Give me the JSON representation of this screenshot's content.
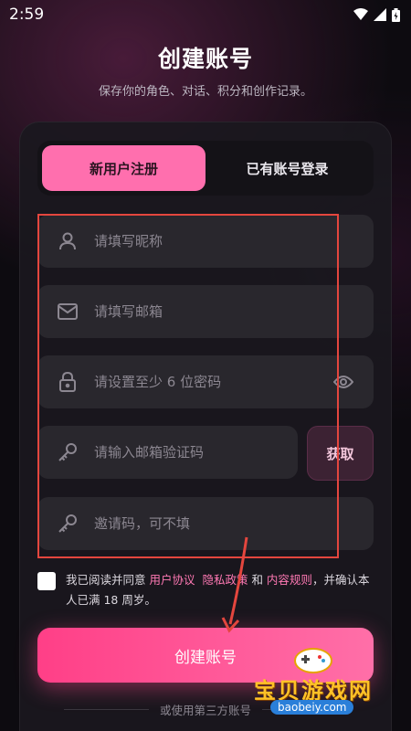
{
  "status_bar": {
    "time": "2:59"
  },
  "header": {
    "title": "创建账号",
    "subtitle": "保存你的角色、对话、积分和创作记录。"
  },
  "tabs": [
    {
      "label": "新用户注册",
      "active": true
    },
    {
      "label": "已有账号登录",
      "active": false
    }
  ],
  "form": {
    "nickname_placeholder": "请填写昵称",
    "email_placeholder": "请填写邮箱",
    "password_placeholder": "请设置至少 6 位密码",
    "code_placeholder": "请输入邮箱验证码",
    "get_code_label": "获取",
    "invite_placeholder": "邀请码，可不填"
  },
  "agreement": {
    "prefix": "我已阅读并同意 ",
    "user_agreement": "用户协议",
    "privacy_policy": "隐私政策",
    "and": " 和 ",
    "content_rules": "内容规则",
    "suffix": "，并确认本人已满 18 周岁。",
    "checked": false
  },
  "create_button_label": "创建账号",
  "third_party_label": "或使用第三方账号",
  "watermark": {
    "text": "宝贝游戏网",
    "url": "baobeiy.com"
  },
  "colors": {
    "accent": "#ff6fae",
    "button": "#ff4f92",
    "highlight": "#e4463e",
    "background": "#0d0b10"
  }
}
